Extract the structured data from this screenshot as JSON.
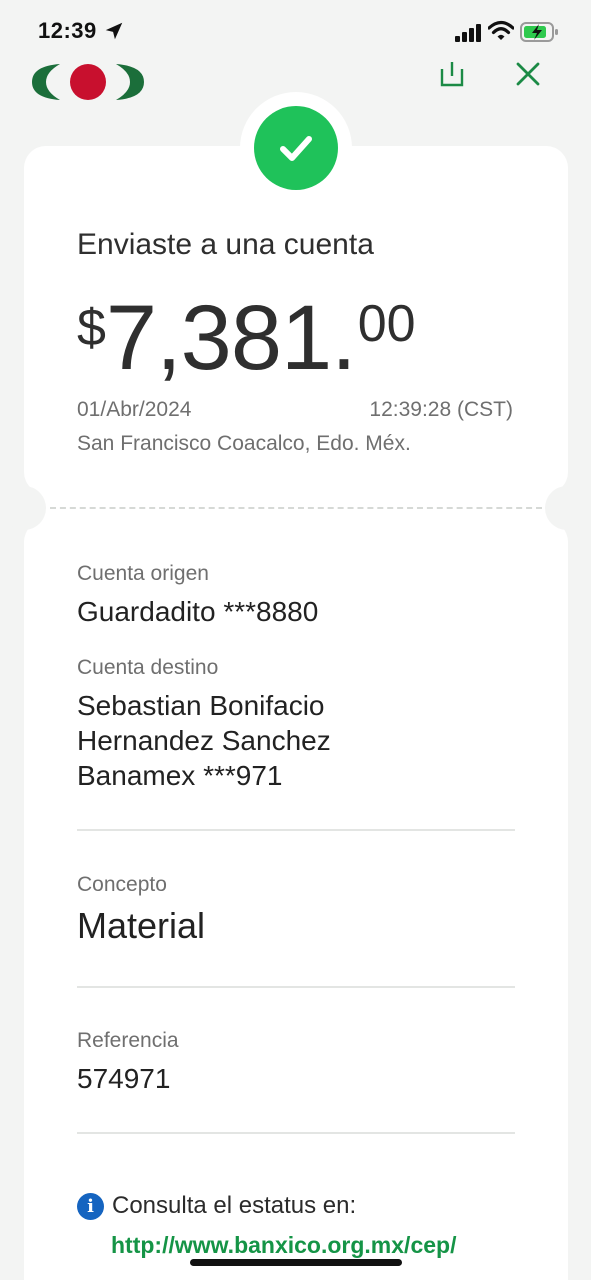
{
  "status_bar": {
    "time": "12:39",
    "icons": [
      "location-arrow-icon",
      "cellular-signal-icon",
      "wifi-icon",
      "battery-charging-icon"
    ]
  },
  "header": {
    "logo": "bank-logo",
    "share_icon": "share-icon",
    "close_icon": "close-icon"
  },
  "colors": {
    "accent_green": "#1fc25a",
    "brand_green": "#1b6e3a",
    "brand_red": "#c8102e",
    "link_green": "#159446",
    "info_blue": "#1564c0"
  },
  "receipt": {
    "title": "Enviaste a una cuenta",
    "amount": {
      "currency": "$",
      "integer": "7,381.",
      "cents": "00"
    },
    "date": "01/Abr/2024",
    "time": "12:39:28 (CST)",
    "location": "San Francisco Coacalco, Edo. Méx."
  },
  "details": {
    "origin_label": "Cuenta origen",
    "origin_value": "Guardadito ***8880",
    "destination_label": "Cuenta destino",
    "destination_lines": [
      "Sebastian Bonifacio",
      "Hernandez Sanchez",
      "Banamex ***971"
    ],
    "concept_label": "Concepto",
    "concept_value": "Material",
    "reference_label": "Referencia",
    "reference_value": "574971"
  },
  "footer": {
    "info_icon_glyph": "i",
    "info_text": "Consulta el estatus en:",
    "link_text": "http://www.banxico.org.mx/cep/"
  }
}
